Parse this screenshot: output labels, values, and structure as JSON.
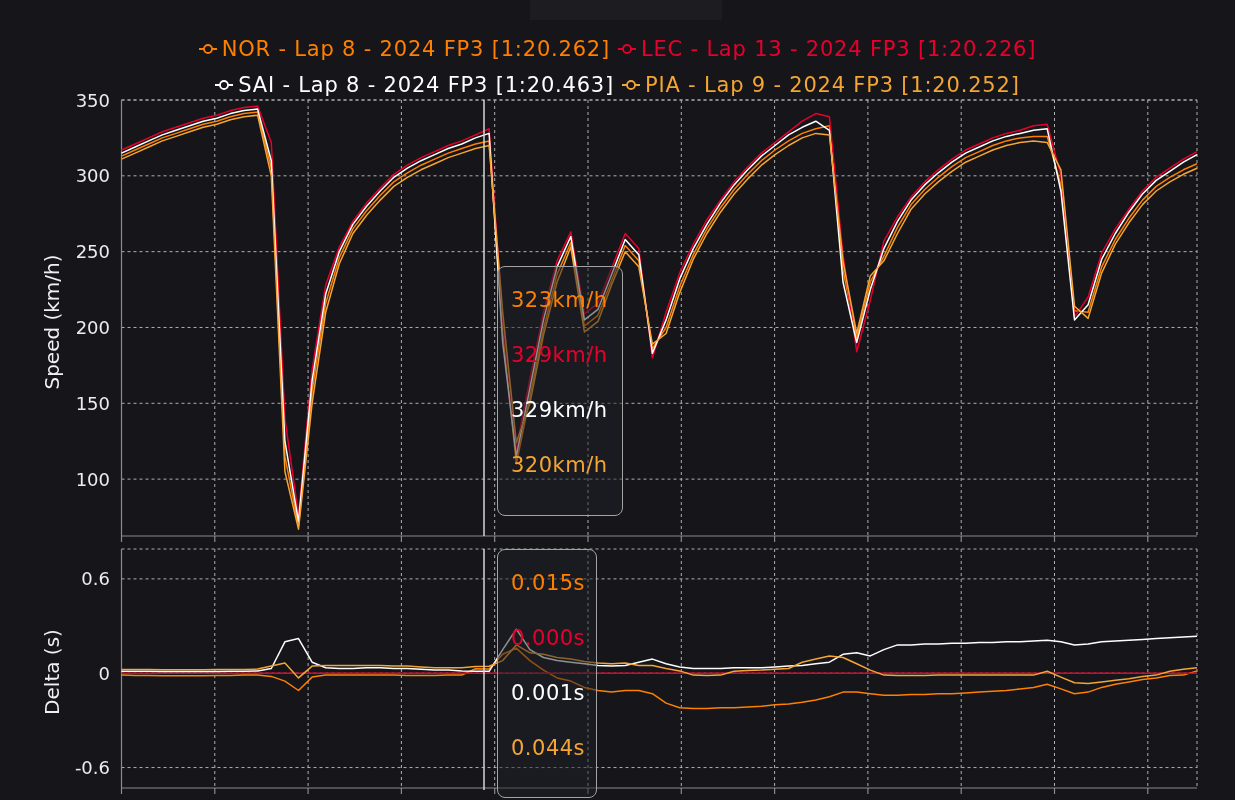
{
  "legend": [
    {
      "label": "NOR - Lap 8 - 2024 FP3 [1:20.262]",
      "color": "#ff8000"
    },
    {
      "label": "LEC - Lap 13 - 2024 FP3 [1:20.226]",
      "color": "#e8002d"
    },
    {
      "label": "SAI - Lap 8 - 2024 FP3 [1:20.463]",
      "color": "#ffffff"
    },
    {
      "label": "PIA - Lap 9 - 2024 FP3 [1:20.252]",
      "color": "#f4a534"
    }
  ],
  "speed_chart": {
    "chart_data": {
      "type": "line",
      "ylabel": "Speed (km/h)",
      "ylim": [
        62.5,
        350
      ],
      "yticks": [
        100,
        150,
        200,
        250,
        300,
        350
      ],
      "grid": true,
      "series": [
        {
          "color": "#ff8000",
          "values": [
            313,
            317,
            321,
            325,
            328,
            331,
            334,
            336,
            339,
            341,
            342,
            305,
            115,
            69,
            158,
            216,
            246,
            265,
            277,
            287,
            296,
            302,
            307,
            311,
            315,
            318,
            321,
            323,
            198,
            110,
            154,
            199,
            235,
            256,
            201,
            208,
            231,
            254,
            244,
            186,
            200,
            227,
            248,
            265,
            279,
            291,
            301,
            310,
            317,
            323,
            328,
            331,
            333,
            238,
            193,
            230,
            247,
            266,
            281,
            291,
            299,
            306,
            312,
            316,
            320,
            323,
            325,
            326,
            326,
            294,
            211,
            210,
            240,
            258,
            272,
            284,
            293,
            299,
            304,
            308
          ]
        },
        {
          "color": "#e8002d",
          "values": [
            317,
            321,
            325,
            329,
            332,
            335,
            338,
            340,
            343,
            345,
            346,
            322,
            140,
            76,
            172,
            228,
            253,
            270,
            282,
            292,
            301,
            307,
            312,
            316,
            320,
            323,
            327,
            331,
            205,
            120,
            166,
            210,
            244,
            263,
            209,
            216,
            239,
            262,
            252,
            180,
            210,
            236,
            255,
            271,
            284,
            296,
            306,
            315,
            322,
            329,
            336,
            341,
            339,
            248,
            184,
            218,
            257,
            273,
            286,
            296,
            304,
            311,
            317,
            321,
            325,
            328,
            330,
            333,
            334,
            300,
            207,
            220,
            249,
            265,
            278,
            290,
            299,
            305,
            311,
            316
          ]
        },
        {
          "color": "#ffffff",
          "values": [
            315,
            319,
            323,
            327,
            330,
            333,
            336,
            338,
            341,
            343,
            344,
            310,
            125,
            72,
            165,
            222,
            250,
            268,
            280,
            290,
            299,
            305,
            310,
            314,
            318,
            321,
            325,
            328,
            190,
            115,
            160,
            205,
            240,
            260,
            205,
            212,
            235,
            258,
            248,
            183,
            205,
            232,
            252,
            268,
            282,
            294,
            304,
            313,
            320,
            327,
            332,
            336,
            330,
            230,
            190,
            225,
            252,
            270,
            284,
            294,
            302,
            309,
            315,
            319,
            323,
            326,
            328,
            330,
            331,
            290,
            205,
            215,
            245,
            262,
            276,
            288,
            297,
            303,
            309,
            314
          ]
        },
        {
          "color": "#f4a534",
          "values": [
            311,
            315,
            319,
            323,
            326,
            329,
            332,
            334,
            337,
            339,
            340,
            300,
            105,
            67,
            150,
            210,
            242,
            262,
            274,
            284,
            293,
            299,
            304,
            308,
            312,
            315,
            318,
            320,
            210,
            124,
            150,
            195,
            230,
            253,
            197,
            204,
            228,
            250,
            240,
            189,
            196,
            223,
            245,
            262,
            276,
            288,
            298,
            307,
            314,
            320,
            325,
            328,
            327,
            244,
            196,
            234,
            244,
            262,
            278,
            288,
            296,
            303,
            309,
            313,
            317,
            320,
            322,
            323,
            322,
            304,
            214,
            206,
            236,
            255,
            269,
            281,
            290,
            296,
            301,
            305
          ]
        }
      ]
    },
    "tooltip": [
      {
        "text": "323km/h",
        "color": "#ff8000"
      },
      {
        "text": "329km/h",
        "color": "#e8002d"
      },
      {
        "text": "329km/h",
        "color": "#ffffff"
      },
      {
        "text": "320km/h",
        "color": "#f4a534"
      }
    ]
  },
  "delta_chart": {
    "chart_data": {
      "type": "line",
      "ylabel": "Delta (s)",
      "ylim": [
        -0.73,
        0.79
      ],
      "yticks": [
        -0.6,
        0,
        0.6
      ],
      "grid": true,
      "series": [
        {
          "color": "#ff8000",
          "values": [
            -0.012,
            -0.014,
            -0.015,
            -0.016,
            -0.016,
            -0.016,
            -0.016,
            -0.015,
            -0.014,
            -0.012,
            -0.012,
            -0.02,
            -0.05,
            -0.11,
            -0.025,
            -0.012,
            -0.012,
            -0.012,
            -0.012,
            -0.012,
            -0.012,
            -0.014,
            -0.015,
            -0.014,
            -0.012,
            -0.012,
            0.028,
            0.026,
            0.12,
            0.16,
            0.08,
            0.02,
            -0.03,
            -0.05,
            -0.09,
            -0.11,
            -0.12,
            -0.11,
            -0.11,
            -0.13,
            -0.19,
            -0.22,
            -0.225,
            -0.225,
            -0.22,
            -0.22,
            -0.215,
            -0.21,
            -0.2,
            -0.195,
            -0.185,
            -0.17,
            -0.15,
            -0.12,
            -0.12,
            -0.13,
            -0.14,
            -0.14,
            -0.135,
            -0.135,
            -0.13,
            -0.13,
            -0.125,
            -0.12,
            -0.115,
            -0.11,
            -0.1,
            -0.09,
            -0.07,
            -0.1,
            -0.13,
            -0.12,
            -0.09,
            -0.07,
            -0.055,
            -0.04,
            -0.03,
            -0.015,
            -0.012,
            0.015
          ]
        },
        {
          "color": "#e8002d",
          "values": [
            0,
            0,
            0,
            0,
            0,
            0,
            0,
            0,
            0,
            0,
            0,
            0,
            0,
            0,
            0,
            0,
            0,
            0,
            0,
            0,
            0,
            0,
            0,
            0,
            0,
            0,
            0,
            0,
            0,
            0,
            0,
            0,
            0,
            0,
            0,
            0,
            0,
            0,
            0,
            0,
            0,
            0,
            0,
            0,
            0,
            0,
            0,
            0,
            0,
            0,
            0,
            0,
            0,
            0,
            0,
            0,
            0,
            0,
            0,
            0,
            0,
            0,
            0,
            0,
            0,
            0,
            0,
            0,
            0,
            0,
            0,
            0,
            0,
            0,
            0,
            0,
            0,
            0,
            0,
            0
          ]
        },
        {
          "color": "#ffffff",
          "values": [
            0.012,
            0.012,
            0.012,
            0.01,
            0.01,
            0.01,
            0.01,
            0.01,
            0.012,
            0.012,
            0.015,
            0.03,
            0.2,
            0.22,
            0.07,
            0.035,
            0.03,
            0.03,
            0.035,
            0.035,
            0.03,
            0.03,
            0.025,
            0.02,
            0.02,
            0.015,
            0.012,
            0.012,
            0.15,
            0.28,
            0.15,
            0.1,
            0.08,
            0.07,
            0.06,
            0.05,
            0.045,
            0.05,
            0.07,
            0.09,
            0.06,
            0.04,
            0.03,
            0.03,
            0.03,
            0.035,
            0.035,
            0.035,
            0.04,
            0.045,
            0.05,
            0.06,
            0.07,
            0.12,
            0.13,
            0.11,
            0.15,
            0.18,
            0.18,
            0.185,
            0.185,
            0.19,
            0.19,
            0.195,
            0.195,
            0.2,
            0.2,
            0.205,
            0.21,
            0.2,
            0.18,
            0.185,
            0.2,
            0.205,
            0.21,
            0.215,
            0.22,
            0.225,
            0.23,
            0.235
          ]
        },
        {
          "color": "#f4a534",
          "values": [
            0.024,
            0.024,
            0.024,
            0.022,
            0.022,
            0.022,
            0.022,
            0.024,
            0.024,
            0.024,
            0.026,
            0.045,
            0.065,
            -0.03,
            0.045,
            0.05,
            0.05,
            0.05,
            0.05,
            0.05,
            0.045,
            0.045,
            0.04,
            0.035,
            0.035,
            0.035,
            0.042,
            0.044,
            0.08,
            0.18,
            0.13,
            0.12,
            0.1,
            0.09,
            0.075,
            0.065,
            0.06,
            0.065,
            0.05,
            0.05,
            0.03,
            0.015,
            -0.012,
            -0.014,
            -0.012,
            0.012,
            0.018,
            0.02,
            0.025,
            0.03,
            0.07,
            0.09,
            0.11,
            0.1,
            0.06,
            0.02,
            -0.012,
            -0.015,
            -0.015,
            -0.015,
            -0.012,
            -0.012,
            -0.012,
            -0.012,
            -0.012,
            -0.012,
            -0.012,
            -0.012,
            0.012,
            -0.025,
            -0.06,
            -0.065,
            -0.055,
            -0.045,
            -0.035,
            -0.02,
            -0.012,
            0.012,
            0.025,
            0.035
          ]
        }
      ]
    },
    "tooltip": [
      {
        "text": "0.015s",
        "color": "#ff8000"
      },
      {
        "text": "0.000s",
        "color": "#e8002d"
      },
      {
        "text": "0.001s",
        "color": "#ffffff"
      },
      {
        "text": "0.044s",
        "color": "#f4a534"
      }
    ]
  }
}
